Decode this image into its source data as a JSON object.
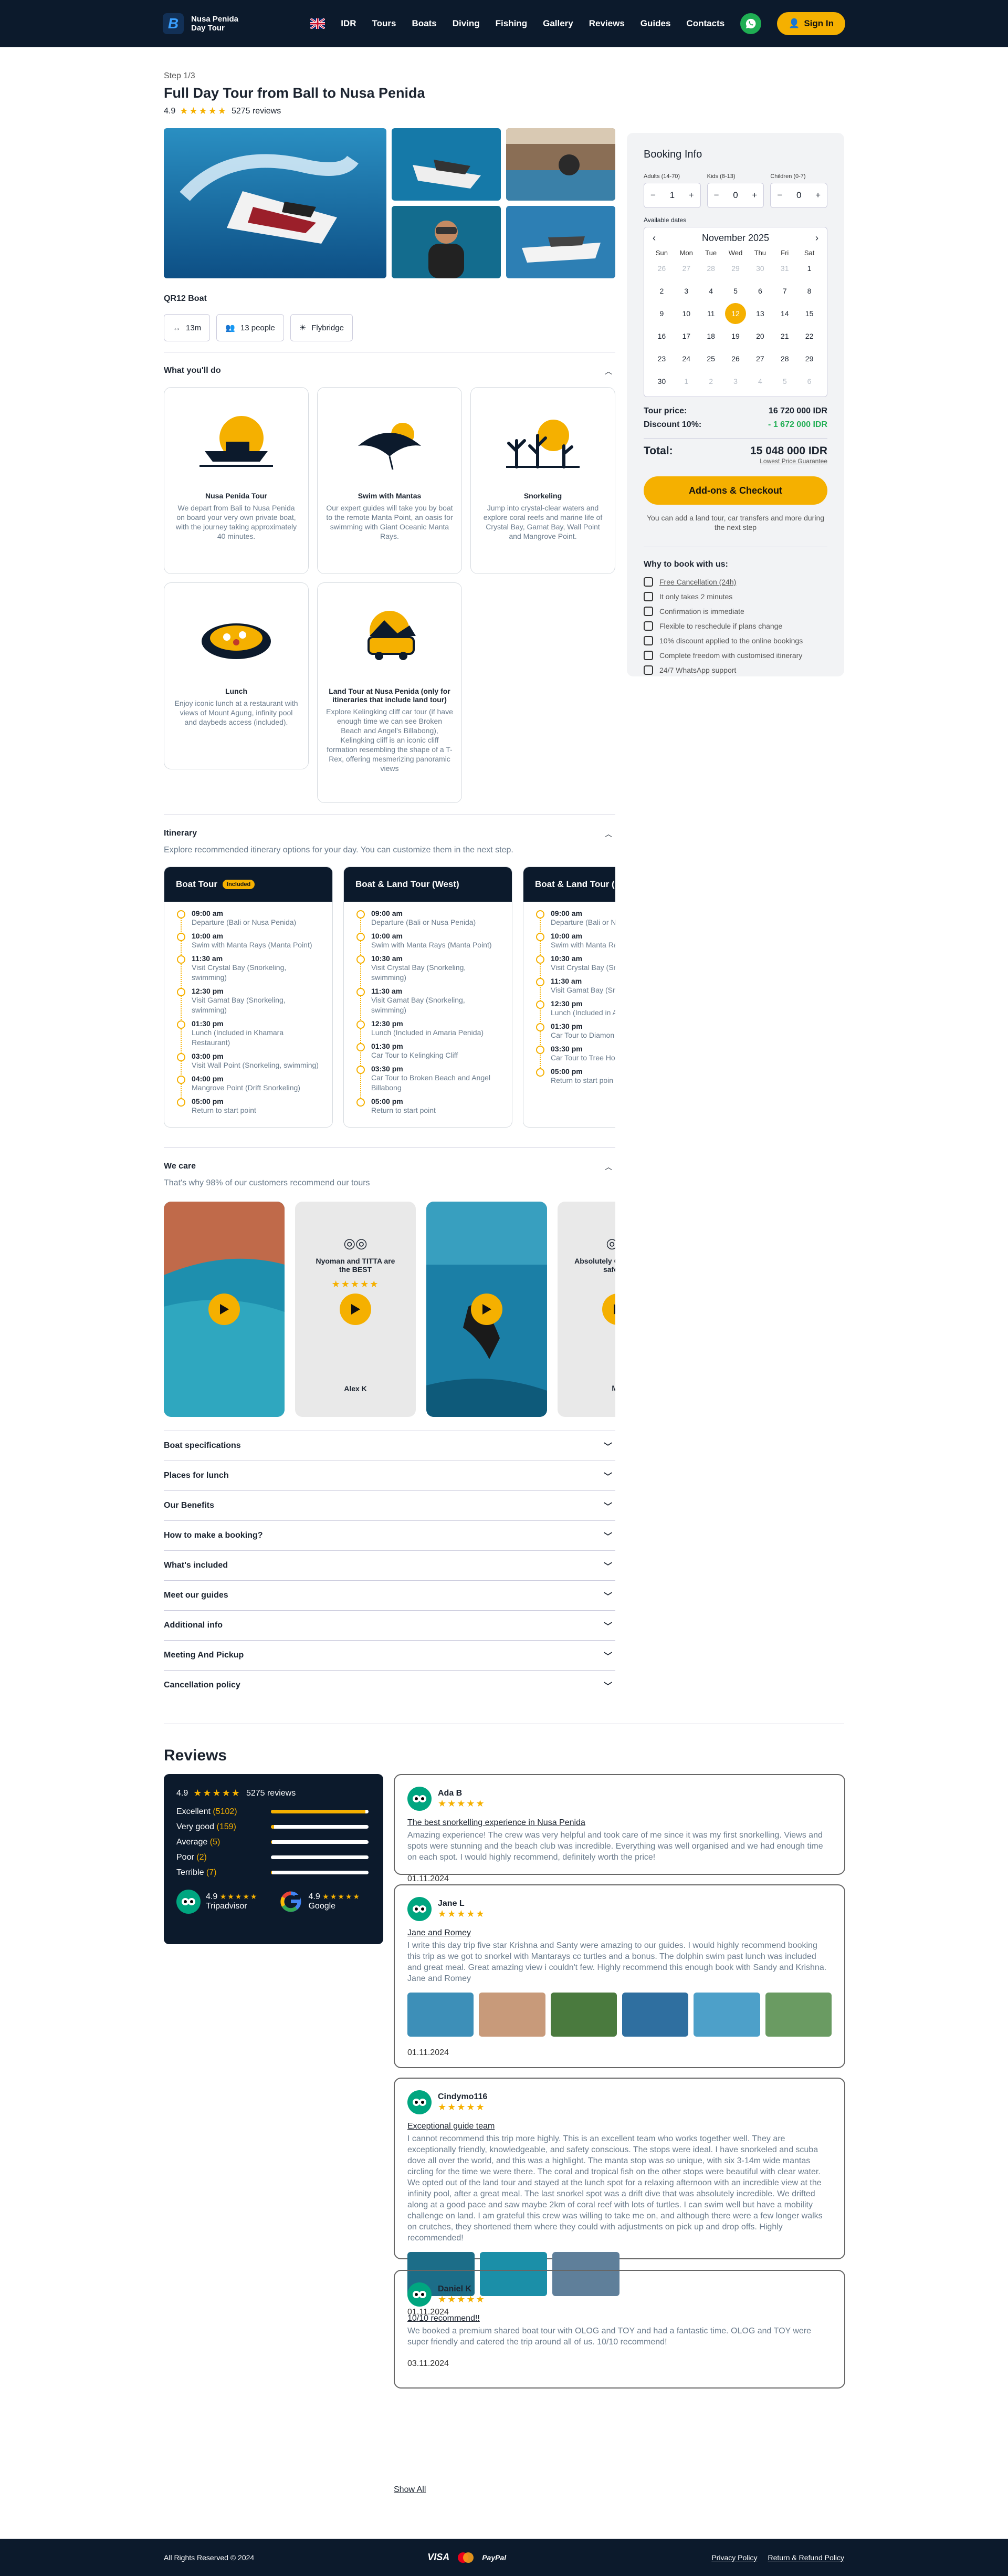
{
  "header": {
    "brand_line1": "Nusa Penida",
    "brand_line2": "Day Tour",
    "lang": "IDR",
    "nav": [
      "Tours",
      "Boats",
      "Diving",
      "Fishing",
      "Gallery",
      "Reviews",
      "Guides",
      "Contacts"
    ],
    "signin": "Sign In"
  },
  "tour": {
    "step": "Step 1/3",
    "title": "Full Day Tour from Ball to Nusa Penida",
    "rating": "4.9",
    "stars": "★★★★★",
    "reviews": "5275 reviews"
  },
  "boat": {
    "name": "QR12 Boat",
    "chips": [
      "13m",
      "13 people",
      "Flybridge"
    ]
  },
  "todo": {
    "title": "What you'll do",
    "cards": [
      {
        "title": "Nusa Penida Tour",
        "text": "We depart from Bali to Nusa Penida on board your very own private boat, with the journey taking approximately 40 minutes."
      },
      {
        "title": "Swim with Mantas",
        "text": "Our expert guides will take you by boat to the remote Manta Point, an oasis for swimming with Giant Oceanic Manta Rays."
      },
      {
        "title": "Snorkeling",
        "text": "Jump into crystal-clear waters and explore coral reefs and marine life of Crystal Bay, Gamat Bay, Wall Point and Mangrove Point."
      },
      {
        "title": "Lunch",
        "text": "Enjoy iconic lunch at a restaurant with views of Mount Agung, infinity pool and daybeds access (included)."
      },
      {
        "title": "Land Tour at Nusa Penida (only for itineraries that include land tour)",
        "text": "Explore Kelingking cliff car tour (if have enough time we can see Broken Beach and Angel's Billabong), Kelingking cliff is an iconic cliff formation resembling the shape of a T-Rex, offering mesmerizing panoramic views"
      }
    ]
  },
  "itinerary": {
    "title": "Itinerary",
    "subtitle": "Explore recommended itinerary options for your day. You can customize them in the next step.",
    "tours": [
      {
        "name": "Boat Tour",
        "badge": "Included",
        "steps": [
          [
            "09:00 am",
            "Departure (Bali or Nusa Penida)"
          ],
          [
            "10:00 am",
            "Swim with Manta Rays (Manta Point)"
          ],
          [
            "11:30 am",
            "Visit Crystal Bay (Snorkeling, swimming)"
          ],
          [
            "12:30 pm",
            "Visit Gamat Bay (Snorkeling, swimming)"
          ],
          [
            "01:30 pm",
            "Lunch (Included in Khamara Restaurant)"
          ],
          [
            "03:00 pm",
            "Visit Wall Point (Snorkeling, swimming)"
          ],
          [
            "04:00 pm",
            "Mangrove Point (Drift Snorkeling)"
          ],
          [
            "05:00 pm",
            "Return to start point"
          ]
        ]
      },
      {
        "name": "Boat & Land Tour (West)",
        "badge": "",
        "steps": [
          [
            "09:00 am",
            "Departure (Bali or Nusa Penida)"
          ],
          [
            "10:00 am",
            "Swim with Manta Rays (Manta Point)"
          ],
          [
            "10:30 am",
            "Visit Crystal Bay (Snorkeling, swimming)"
          ],
          [
            "11:30 am",
            "Visit Gamat Bay (Snorkeling, swimming)"
          ],
          [
            "12:30 pm",
            "Lunch (Included in Amaria Penida)"
          ],
          [
            "01:30 pm",
            "Car Tour to Kelingking Cliff"
          ],
          [
            "03:30 pm",
            "Car Tour to Broken Beach and Angel Billabong"
          ],
          [
            "05:00 pm",
            "Return to start point"
          ]
        ]
      },
      {
        "name": "Boat & Land Tour (E",
        "badge": "",
        "steps": [
          [
            "09:00 am",
            "Departure (Bali or Nu"
          ],
          [
            "10:00 am",
            "Swim with Manta Ray"
          ],
          [
            "10:30 am",
            "Visit Crystal Bay (Sn swimming)"
          ],
          [
            "11:30 am",
            "Visit Gamat Bay (Sno swimming)"
          ],
          [
            "12:30 pm",
            "Lunch (Included in A"
          ],
          [
            "01:30 pm",
            "Car Tour to Diamon"
          ],
          [
            "03:30 pm",
            "Car Tour to Tree Ho"
          ],
          [
            "05:00 pm",
            "Return to start poin"
          ]
        ]
      }
    ]
  },
  "care": {
    "title": "We care",
    "subtitle": "That's why 98% of our customers recommend our tours",
    "review1_title": "Nyoman and TITTA are the BEST",
    "review1_author": "Alex K",
    "review2_title": "Absolutely Great boat so safe, am",
    "review2_author": "Mili"
  },
  "accordions": [
    "Boat specifications",
    "Places for lunch",
    "Our Benefits",
    "How to make a booking?",
    "What's included",
    "Meet our guides",
    "Additional info",
    "Meeting And Pickup",
    "Cancellation policy"
  ],
  "booking": {
    "title": "Booking Info",
    "adults_label": "Adults (14-70)",
    "adults": "1",
    "kids_label": "Kids (8-13)",
    "kids": "0",
    "children_label": "Children (0-7)",
    "children": "0",
    "avail": "Available dates",
    "month": "November",
    "year": "2025",
    "dow": [
      "Sun",
      "Mon",
      "Tue",
      "Wed",
      "Thu",
      "Fri",
      "Sat"
    ],
    "days": [
      "26",
      "27",
      "28",
      "29",
      "30",
      "31",
      "1",
      "2",
      "3",
      "4",
      "5",
      "6",
      "7",
      "8",
      "9",
      "10",
      "11",
      "12",
      "13",
      "14",
      "15",
      "16",
      "17",
      "18",
      "19",
      "20",
      "21",
      "22",
      "23",
      "24",
      "25",
      "26",
      "27",
      "28",
      "29",
      "30",
      "1",
      "2",
      "3",
      "4",
      "5",
      "6"
    ],
    "tour_price_label": "Tour price:",
    "tour_price": "16 720 000 IDR",
    "discount_label": "Discount 10%:",
    "discount": "- 1 672 000 IDR",
    "total_label": "Total:",
    "total": "15 048 000 IDR",
    "guarantee": "Lowest Price Guarantee",
    "cta": "Add-ons & Checkout",
    "hint": "You can add a land tour, car transfers and more during the next step",
    "why_title": "Why to book with us:",
    "why": [
      "Free Cancellation (24h)",
      "It only takes 2 minutes",
      "Confirmation is immediate",
      "Flexible to reschedule if plans change",
      "10% discount applied to the online bookings",
      "Complete freedom with customised itinerary",
      "24/7 WhatsApp support"
    ]
  },
  "reviews": {
    "title": "Reviews",
    "rating": "4.9",
    "count": "5275 reviews",
    "bars": [
      [
        "Excellent",
        "(5102)",
        0.97
      ],
      [
        "Very good",
        "(159)",
        0.03
      ],
      [
        "Average",
        "(5)",
        0.01
      ],
      [
        "Poor",
        "(2)",
        0
      ],
      [
        "Terrible",
        "(7)",
        0.01
      ]
    ],
    "ta_rating": "4.9",
    "ta": "Tripadvisor",
    "g_rating": "4.9",
    "g": "Google",
    "items": [
      {
        "name": "Ada B",
        "title": "The best snorkelling experience in Nusa Penida",
        "text": "Amazing experience! The crew was very helpful and took care of me since it was my first snorkelling. Views and spots were stunning and the beach club was incredible. Everything was well organised and we had enough time on each spot. I would highly recommend, definitely worth the price!",
        "date": "01.11.2024"
      },
      {
        "name": "Jane L",
        "title": "Jane and Romey",
        "text": "I write this day trip five star Krishna and Santy were amazing to our guides. I would highly recommend booking this trip as we got to snorkel with Mantarays cc turtles and a bonus. The dolphin swim past lunch was included and great meal. Great amazing view i couldn't few. Highly recommend this enough book with Sandy and Krishna.\nJane and Romey",
        "date": "01.11.2024"
      },
      {
        "name": "Cindymo116",
        "title": "Exceptional guide team",
        "text": "I cannot recommend this trip more highly. This is an excellent team who works together well. They are exceptionally friendly, knowledgeable, and safety conscious. The stops were ideal. I have snorkeled and scuba dove all over the world, and this was a highlight. The manta stop was so unique, with six 3-14m wide mantas circling for the time we were there. The coral and tropical fish on the other stops were beautiful with clear water. We opted out of the land tour and stayed at the lunch spot for a relaxing afternoon with an incredible view at the infinity pool, after a great meal. The last snorkel spot was a drift dive that was absolutely incredible. We drifted along at a good pace and saw maybe 2km of coral reef with lots of turtles. I can swim well but have a mobility challenge on land. I am grateful this crew was willing to take me on, and although there were a few longer walks on crutches, they shortened them where they could with adjustments on pick up and drop offs. Highly recommended!",
        "date": "01.11.2024"
      },
      {
        "name": "Daniel K",
        "title": "10/10 recommend!!",
        "text": "We booked a premium shared boat tour with OLOG and TOY and had a fantastic time. OLOG and TOY were super friendly and catered the trip around all of us. 10/10 recommend!",
        "date": "03.11.2024"
      }
    ],
    "show_all": "Show All"
  },
  "footer": {
    "copy": "All Rights Reserved © 2024",
    "privacy": "Privacy Policy",
    "refund": "Return & Refund Policy",
    "visa": "VISA",
    "paypal": "PayPal"
  },
  "colors": {
    "navy": "#0c1a2c",
    "accent": "#f5b000",
    "green": "#1fae53"
  }
}
